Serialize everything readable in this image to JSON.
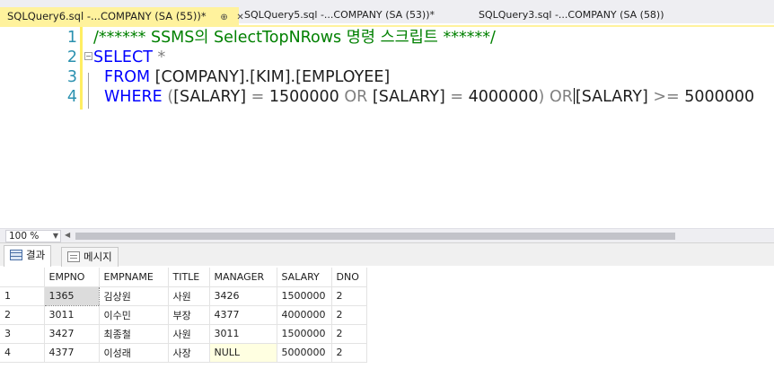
{
  "tabs": [
    {
      "title": "SQLQuery6.sql -...COMPANY (SA (55))*",
      "pin": "⊕",
      "close": "✕"
    },
    {
      "title": "SQLQuery5.sql -...COMPANY (SA (53))*"
    },
    {
      "title": "SQLQuery3.sql -...COMPANY (SA (58))"
    }
  ],
  "editor": {
    "lines": [
      {
        "num": "1",
        "comment": "/****** SSMS의 SelectTopNRows 명령 스크립트 ******/"
      },
      {
        "num": "2",
        "kw": "SELECT",
        "rest": " *"
      },
      {
        "num": "3",
        "kw": "FROM",
        "rest": " [COMPANY].[KIM].[EMPLOYEE]"
      },
      {
        "num": "4",
        "kw": "WHERE",
        "p1": " (",
        "a": "[SALARY]",
        "eq1": " = ",
        "v1": "1500000",
        "or1": " OR ",
        "b": "[SALARY]",
        "eq2": " = ",
        "v2": "4000000",
        "p2": ")",
        "or2": " OR",
        "c": "[SALARY]",
        "ge": " >= ",
        "v3": "5000000"
      }
    ]
  },
  "zoom": {
    "value": "100 %"
  },
  "results": {
    "tabs": [
      {
        "label": "결과",
        "icon": "grid-icon"
      },
      {
        "label": "메시지",
        "icon": "message-icon"
      }
    ],
    "columns": [
      "EMPNO",
      "EMPNAME",
      "TITLE",
      "MANAGER",
      "SALARY",
      "DNO"
    ],
    "rows": [
      {
        "n": "1",
        "cells": [
          "1365",
          "김상원",
          "사원",
          "3426",
          "1500000",
          "2"
        ]
      },
      {
        "n": "2",
        "cells": [
          "3011",
          "이수민",
          "부장",
          "4377",
          "4000000",
          "2"
        ]
      },
      {
        "n": "3",
        "cells": [
          "3427",
          "최종철",
          "사원",
          "3011",
          "1500000",
          "2"
        ]
      },
      {
        "n": "4",
        "cells": [
          "4377",
          "이성래",
          "사장",
          "NULL",
          "5000000",
          "2"
        ]
      }
    ]
  }
}
